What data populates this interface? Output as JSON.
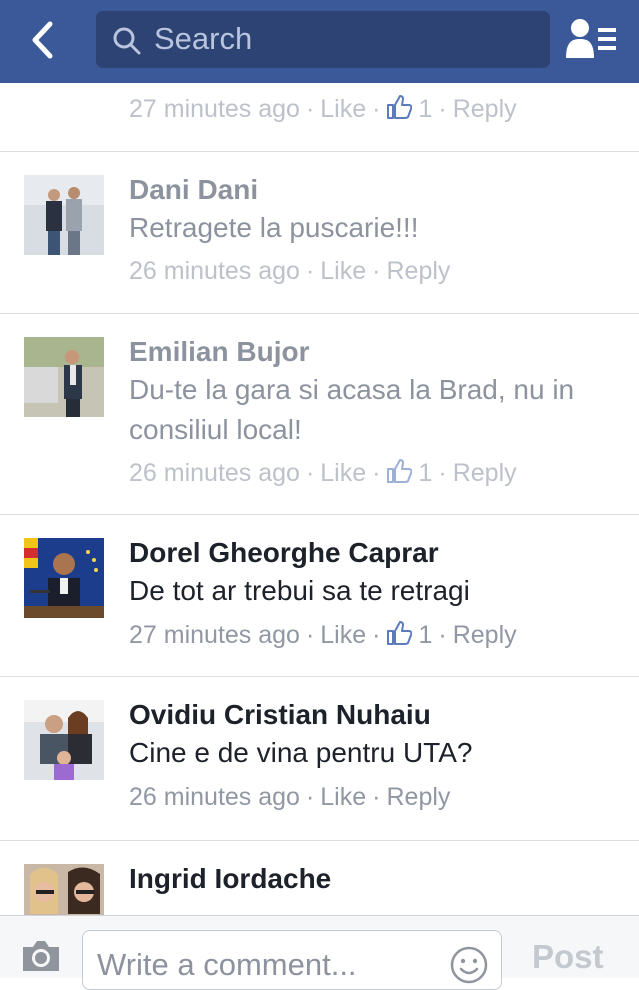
{
  "header": {
    "search_placeholder": "Search",
    "back_icon": "chevron-left-icon",
    "friends_icon": "friend-requests-icon",
    "bar_color": "#3b5998"
  },
  "comments": [
    {
      "name": "",
      "text": "",
      "time": "27 minutes ago",
      "like": "Like",
      "likes": "1",
      "reply": "Reply"
    },
    {
      "name": "Dani Dani",
      "text": "Retragete la puscarie!!!",
      "time": "26 minutes ago",
      "like": "Like",
      "likes": "",
      "reply": "Reply"
    },
    {
      "name": "Emilian Bujor",
      "text": "Du-te la gara si acasa la Brad, nu in consiliul local!",
      "time": "26 minutes ago",
      "like": "Like",
      "likes": "1",
      "reply": "Reply"
    },
    {
      "name": "Dorel Gheorghe Caprar",
      "text": "De tot ar trebui sa te retragi",
      "time": "27 minutes ago",
      "like": "Like",
      "likes": "1",
      "reply": "Reply"
    },
    {
      "name": "Ovidiu Cristian Nuhaiu",
      "text": "Cine e de vina pentru UTA?",
      "time": "26 minutes ago",
      "like": "Like",
      "likes": "",
      "reply": "Reply"
    },
    {
      "name": "Ingrid Iordache",
      "text": "",
      "time": "",
      "like": "",
      "likes": "",
      "reply": ""
    }
  ],
  "composer": {
    "placeholder": "Write a comment...",
    "post_label": "Post",
    "camera_icon": "camera-icon",
    "emoji_icon": "smiley-icon"
  }
}
